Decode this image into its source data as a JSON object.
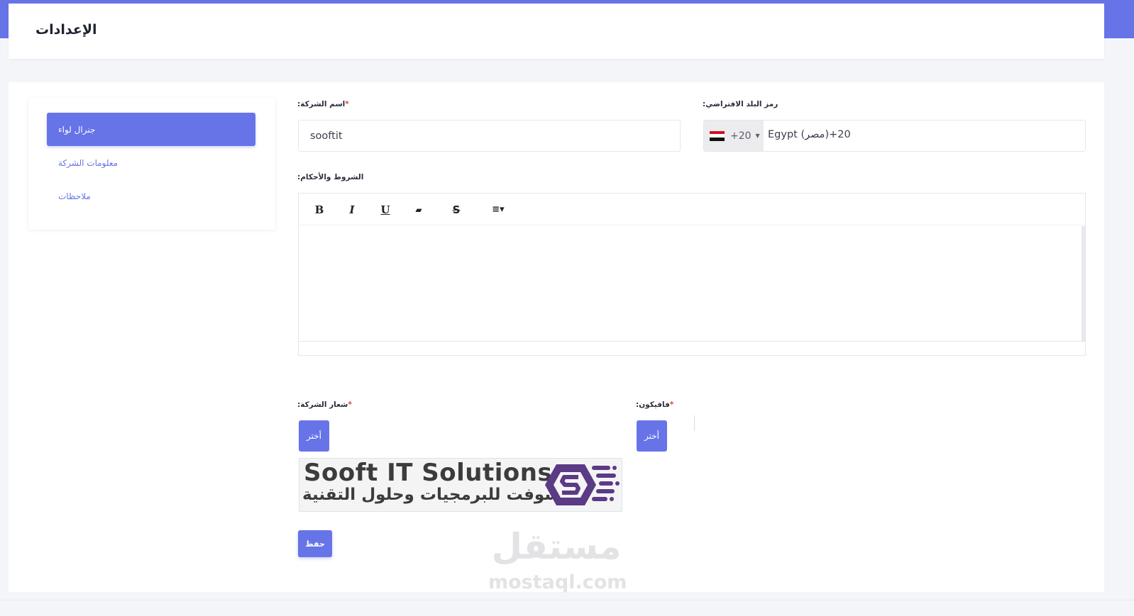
{
  "header": {
    "title": "الإعدادات"
  },
  "sidebar": {
    "items": [
      {
        "label": "جنرال لواء",
        "active": true
      },
      {
        "label": "معلومات الشركة",
        "active": false
      },
      {
        "label": "ملاحظات",
        "active": false
      }
    ]
  },
  "form": {
    "company_name": {
      "label": ":اسم الشركة",
      "required": "*",
      "value": "sooftit"
    },
    "country_code": {
      "label": ":رمز البلد الافتراضي",
      "dial_code": "+20",
      "value": "Egypt (مصر)‎+20",
      "flag": "egypt-flag-icon"
    },
    "terms": {
      "label": ":الشروط والأحكام",
      "toolbar": [
        {
          "name": "bold-icon",
          "glyph": "B"
        },
        {
          "name": "italic-icon",
          "glyph": "I"
        },
        {
          "name": "underline-icon",
          "glyph": "U"
        },
        {
          "name": "eraser-icon",
          "glyph": "▰"
        },
        {
          "name": "strikethrough-icon",
          "glyph": "S"
        },
        {
          "name": "align-icon",
          "glyph": "≡▾"
        }
      ]
    },
    "company_logo": {
      "label": ":شعار الشركة",
      "required": "*",
      "choose_label": "أختر",
      "logo_text_en": "Sooft IT Solutions",
      "logo_text_ar": "سوفت للبرمجيات وحلول التقنية"
    },
    "favicon": {
      "label": ":فافيكون",
      "required": "*",
      "choose_label": "أختر"
    },
    "save_label": "حفظ"
  },
  "watermark": {
    "ar": "مستقل",
    "en": "mostaql.com"
  },
  "colors": {
    "accent": "#6774e8",
    "required": "#e0413f",
    "logo_purple": "#5b3a86"
  }
}
